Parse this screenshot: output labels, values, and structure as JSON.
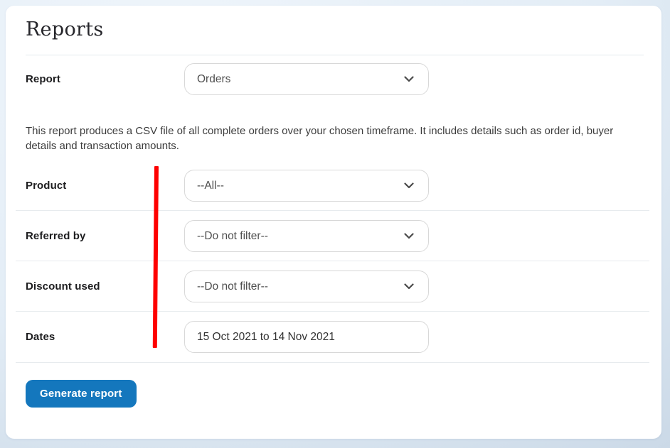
{
  "page": {
    "title": "Reports"
  },
  "colors": {
    "accent": "#1477bd",
    "annotation_line": "#fe0000",
    "card_background": "#ffffff",
    "page_background": "#dfeaf4",
    "field_border": "#d8d8d8"
  },
  "icons": {
    "chevron_down": "v"
  },
  "form": {
    "report": {
      "label": "Report",
      "value": "Orders"
    },
    "description": "This report produces a CSV file of all complete orders over your chosen timeframe. It includes details such as order id, buyer details and transaction amounts.",
    "product": {
      "label": "Product",
      "value": "--All--"
    },
    "referred_by": {
      "label": "Referred by",
      "value": "--Do not filter--"
    },
    "discount_used": {
      "label": "Discount used",
      "value": "--Do not filter--"
    },
    "dates": {
      "label": "Dates",
      "value": "15 Oct 2021 to 14 Nov 2021"
    },
    "submit_label": "Generate report"
  }
}
